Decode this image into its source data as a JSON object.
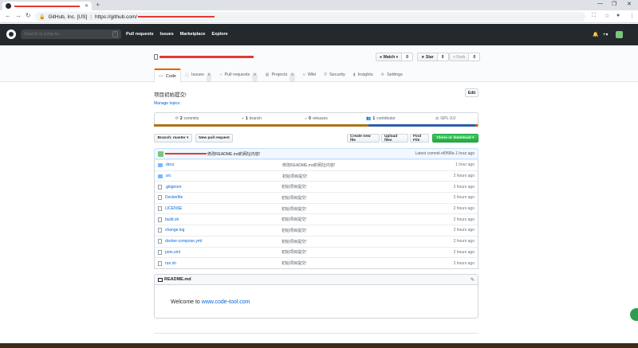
{
  "browser": {
    "new_tab": "+",
    "win_controls": [
      "—",
      "❐",
      "✕"
    ],
    "site_identity": "GitHub, Inc. [US]",
    "url_prefix": "https://github.com/",
    "menu_icon": "⋮"
  },
  "header": {
    "search_placeholder": "Search or jump to...",
    "search_key": "/",
    "nav": [
      "Pull requests",
      "Issues",
      "Marketplace",
      "Explore"
    ],
    "bell": "🔔",
    "plus": "+▾"
  },
  "repo": {
    "watch_label": "● Watch ▾",
    "watch_count": "0",
    "star_label": "★ Star",
    "star_count": "0",
    "fork_label": "⑂ Fork",
    "fork_count": "0",
    "tabs": [
      {
        "label": "Code",
        "icon": "<>",
        "count": ""
      },
      {
        "label": "Issues",
        "icon": "ⓘ",
        "count": "0"
      },
      {
        "label": "Pull requests",
        "icon": "⑂",
        "count": "0"
      },
      {
        "label": "Projects",
        "icon": "▦",
        "count": "0"
      },
      {
        "label": "Wiki",
        "icon": "≡",
        "count": ""
      },
      {
        "label": "Security",
        "icon": "⛨",
        "count": ""
      },
      {
        "label": "Insights",
        "icon": "▮",
        "count": ""
      },
      {
        "label": "Settings",
        "icon": "⚙",
        "count": ""
      }
    ],
    "description": "项目初始提交!",
    "manage_topics": "Manage topics",
    "edit": "Edit"
  },
  "numbers": [
    {
      "icon": "⟳",
      "value": "2",
      "label": "commits"
    },
    {
      "icon": "⑂",
      "value": "1",
      "label": "branch"
    },
    {
      "icon": "⌂",
      "value": "0",
      "label": "releases"
    },
    {
      "icon": "👥",
      "value": "1",
      "label": "contributor"
    },
    {
      "icon": "⚖",
      "value": "",
      "label": "GPL-3.0"
    }
  ],
  "lang_colors": [
    "#b07219",
    "#2b5fa8",
    "#e34c26",
    "#89e051"
  ],
  "file_nav": {
    "branch": "Branch: master ▾",
    "new_pr": "New pull request",
    "create_file": "Create new file",
    "upload": "Upload files",
    "find": "Find File",
    "clone": "Clone or download ▾"
  },
  "commit": {
    "message": "修改README.md的网址内容!",
    "latest": "Latest commit ef0f98a 1 hour ago"
  },
  "files": [
    {
      "type": "dir",
      "name": "docs",
      "message": "修改README.md的网址内容!",
      "age": "1 hour ago"
    },
    {
      "type": "dir",
      "name": "src",
      "message": "初始项目提交!",
      "age": "2 hours ago"
    },
    {
      "type": "file",
      "name": ".gitignore",
      "message": "初始项目提交!",
      "age": "2 hours ago"
    },
    {
      "type": "file",
      "name": "Dockerfile",
      "message": "初始项目提交!",
      "age": "2 hours ago"
    },
    {
      "type": "file",
      "name": "LICENSE",
      "message": "初始项目提交!",
      "age": "2 hours ago"
    },
    {
      "type": "file",
      "name": "build.sh",
      "message": "初始项目提交!",
      "age": "2 hours ago"
    },
    {
      "type": "file",
      "name": "change.log",
      "message": "初始项目提交!",
      "age": "2 hours ago"
    },
    {
      "type": "file",
      "name": "docker-compose.yml",
      "message": "初始项目提交!",
      "age": "2 hours ago"
    },
    {
      "type": "file",
      "name": "pom.xml",
      "message": "初始项目提交!",
      "age": "2 hours ago"
    },
    {
      "type": "file",
      "name": "run.sh",
      "message": "初始项目提交!",
      "age": "2 hours ago"
    }
  ],
  "readme": {
    "title": "README.md",
    "welcome": "Welcome to",
    "link": "www.code-tool.com"
  }
}
